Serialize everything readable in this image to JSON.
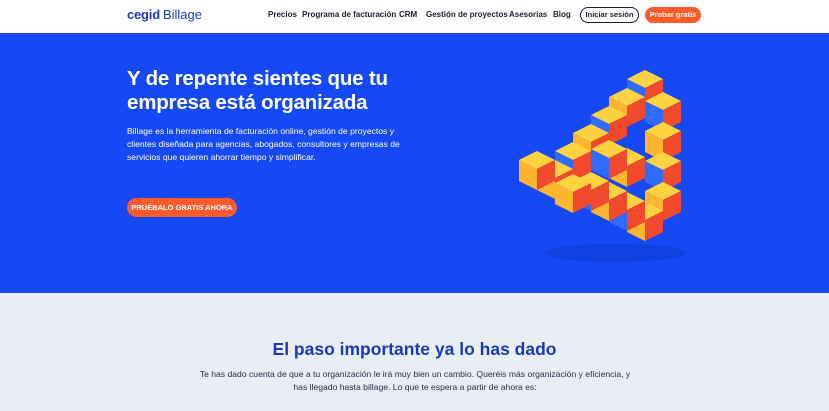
{
  "header": {
    "logo": {
      "brand": "cegid",
      "product": "Billage"
    },
    "nav": [
      {
        "label": "Precios"
      },
      {
        "label": "Programa de facturación"
      },
      {
        "label": "CRM"
      },
      {
        "label": "Gestión de proyectos"
      },
      {
        "label": "Asesorías"
      },
      {
        "label": "Blog"
      }
    ],
    "login_label": "Iniciar sesión",
    "trial_label": "Probar gratis"
  },
  "hero": {
    "title": "Y de repente sientes que tu empresa está organizada",
    "description": "Billage es la herramienta de facturación online, gestión de proyectos y clientes diseñada para agencias, abogados, consultores y empresas de servicios que quieren ahorrar tiempo y simplificar.",
    "cta_label": "PRUÉBALO GRATIS AHORA"
  },
  "section": {
    "title": "El paso importante ya lo has dado",
    "text": "Te has dado cuenta de que a tu organización le irá muy bien un cambio. Queréis más organización y eficiencia, y has llegado hasta billage. Lo que te espera a partir de ahora es:"
  },
  "colors": {
    "primary_blue": "#1449f5",
    "brand_navy": "#1a3bb8",
    "accent_orange": "#ff5a2c",
    "cube_yellow": "#ffd23f",
    "cube_red": "#f0492b",
    "cube_blue": "#2f6bff",
    "section_bg": "#e9eef4"
  }
}
